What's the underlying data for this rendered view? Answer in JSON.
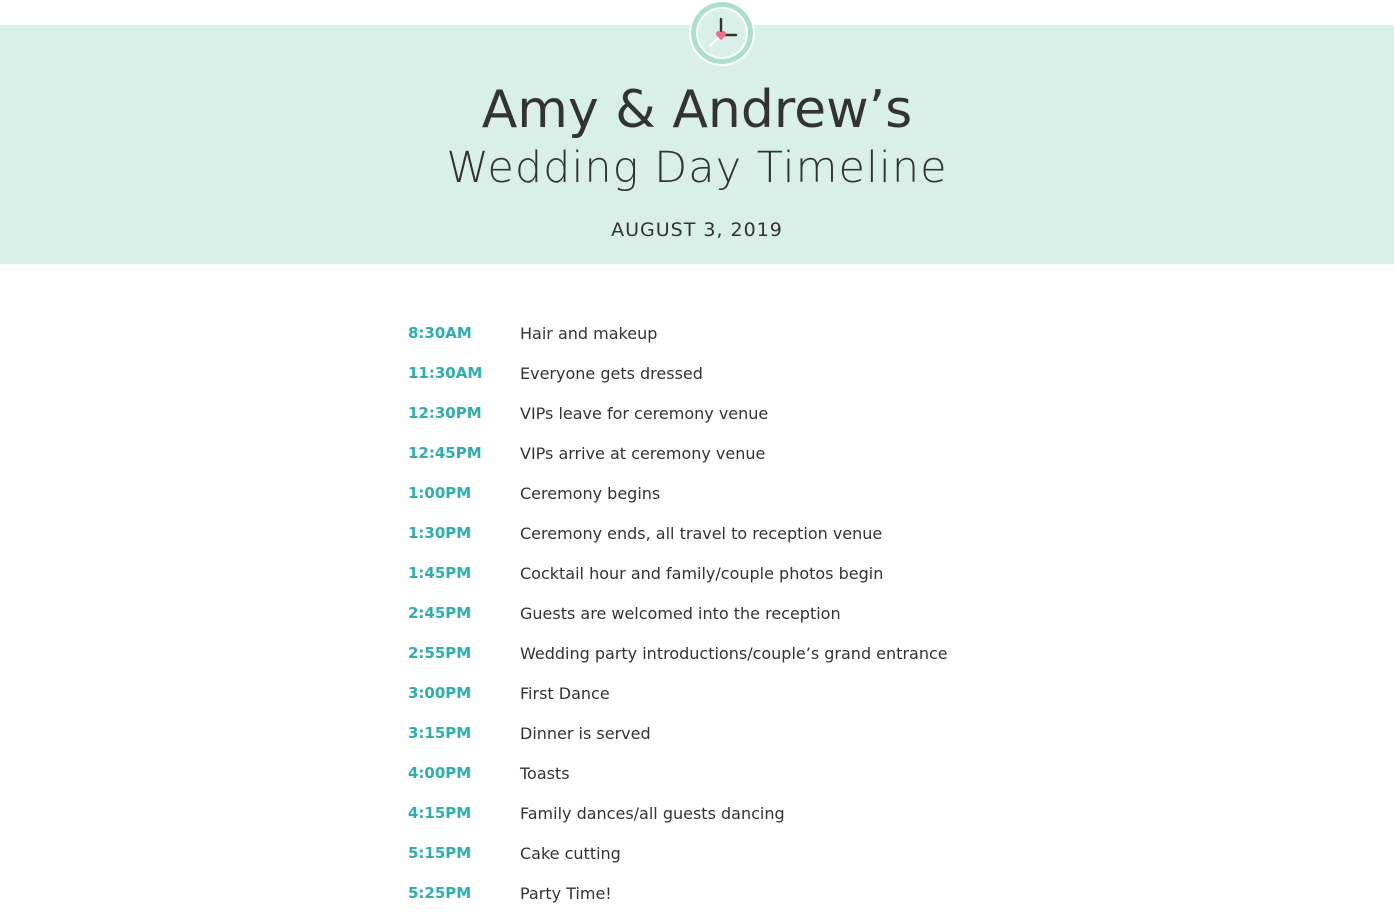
{
  "header": {
    "icon": "clock-heart-icon",
    "title": "Amy & Andrew’s",
    "subtitle": "Wedding Day Timeline",
    "date": "AUGUST 3, 2019"
  },
  "colors": {
    "banner": "#d8f0e8",
    "accent": "#2ab0ad",
    "heart": "#f06a8a",
    "text": "#333333"
  },
  "timeline": [
    {
      "time": "8:30AM",
      "event": "Hair and makeup"
    },
    {
      "time": "11:30AM",
      "event": "Everyone gets dressed"
    },
    {
      "time": "12:30PM",
      "event": "VIPs leave for ceremony venue"
    },
    {
      "time": "12:45PM",
      "event": "VIPs arrive at ceremony venue"
    },
    {
      "time": "1:00PM",
      "event": "Ceremony begins"
    },
    {
      "time": "1:30PM",
      "event": "Ceremony ends, all travel to reception venue"
    },
    {
      "time": "1:45PM",
      "event": "Cocktail hour and family/couple photos begin"
    },
    {
      "time": "2:45PM",
      "event": "Guests are welcomed into the reception"
    },
    {
      "time": "2:55PM",
      "event": "Wedding party introductions/couple’s grand entrance"
    },
    {
      "time": "3:00PM",
      "event": "First Dance"
    },
    {
      "time": "3:15PM",
      "event": "Dinner is served"
    },
    {
      "time": "4:00PM",
      "event": "Toasts"
    },
    {
      "time": "4:15PM",
      "event": "Family dances/all guests dancing"
    },
    {
      "time": "5:15PM",
      "event": "Cake cutting"
    },
    {
      "time": "5:25PM",
      "event": "Party Time!"
    }
  ]
}
